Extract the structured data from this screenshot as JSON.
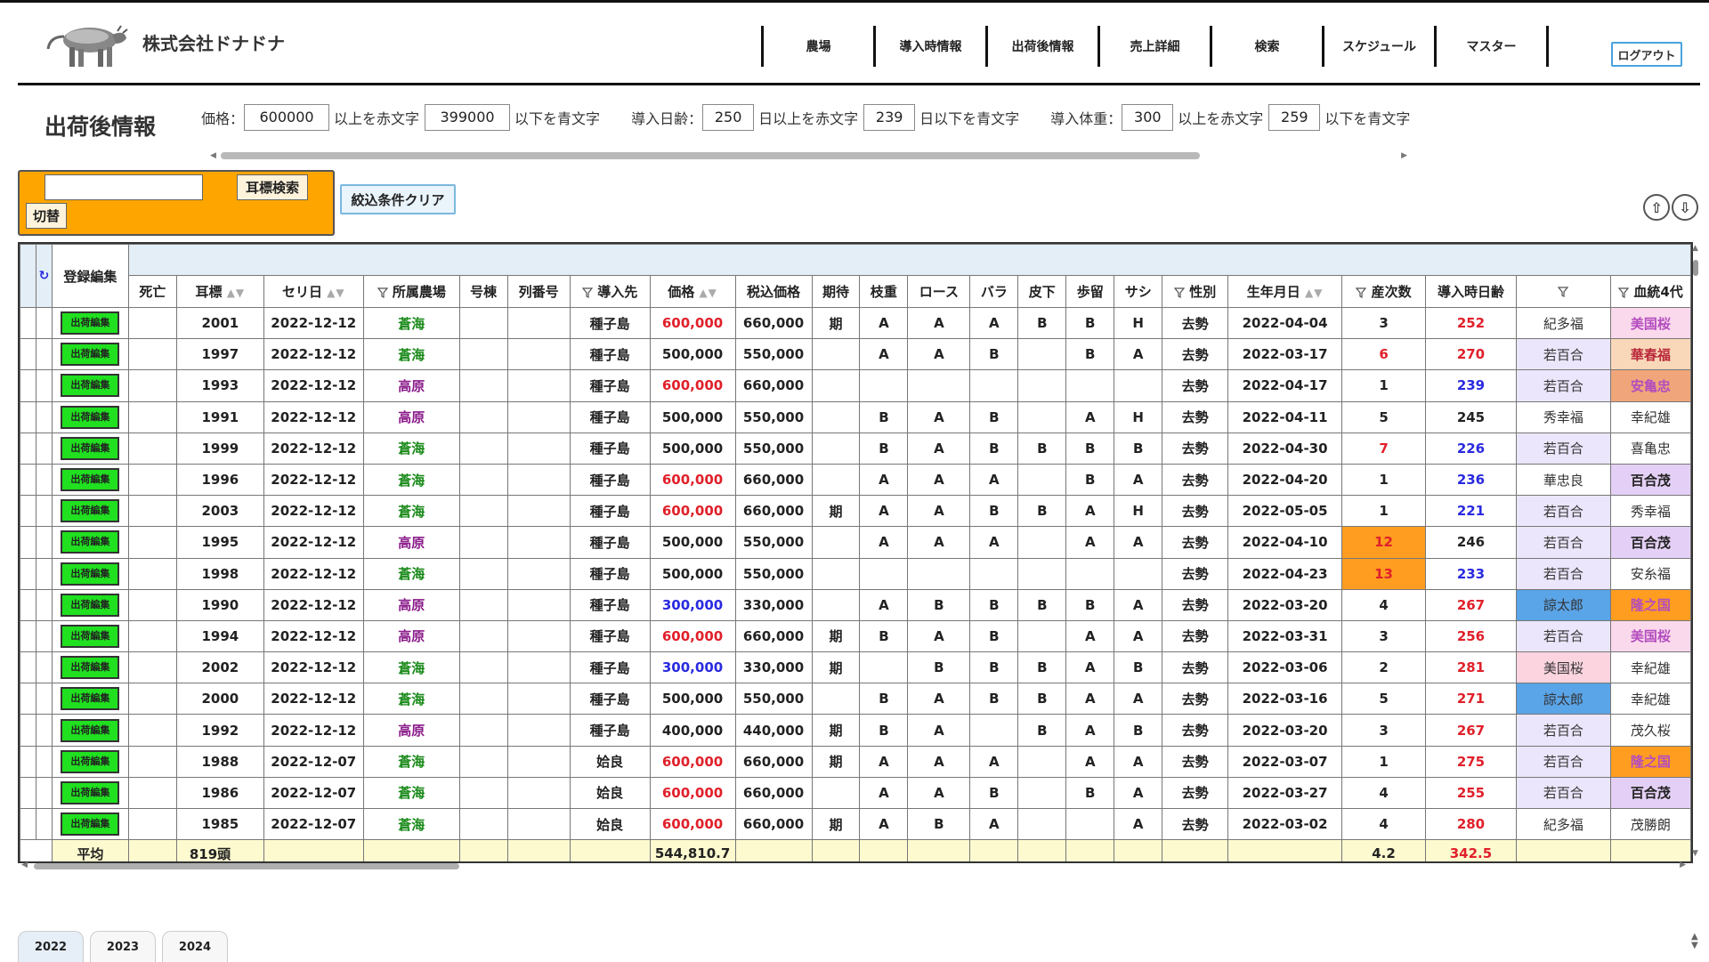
{
  "company": "株式会社ドナドナ",
  "nav": [
    "農場",
    "導入時情報",
    "出荷後情報",
    "売上詳細",
    "検索",
    "スケジュール",
    "マスター"
  ],
  "logout": "ログアウト",
  "page_title": "出荷後情報",
  "filters": [
    {
      "label": "価格：",
      "v1": "600000",
      "t1": "以上を赤文字",
      "v2": "399000",
      "t2": "以下を青文字"
    },
    {
      "label": "導入日齢：",
      "v1": "250",
      "t1": "日以上を赤文字",
      "v2": "239",
      "t2": "日以下を青文字"
    },
    {
      "label": "導入体重：",
      "v1": "300",
      "t1": "以上を赤文字",
      "v2": "259",
      "t2": "以下を青文字"
    }
  ],
  "search": {
    "ear_search": "耳標検索",
    "switch": "切替",
    "clear": "絞込条件クリア",
    "up_icon": "⇧",
    "down_icon": "⇩"
  },
  "table": {
    "group_header": "登録編集",
    "refresh_icon": "↻",
    "columns": [
      "死亡",
      "耳標",
      "セリ日",
      "所属農場",
      "号棟",
      "列番号",
      "導入先",
      "価格",
      "税込価格",
      "期待",
      "枝重",
      "ロース",
      "バラ",
      "皮下",
      "歩留",
      "サシ",
      "性別",
      "生年月日",
      "産次数",
      "導入時日齢",
      "",
      "血統4代"
    ],
    "edit_label": "出荷編集",
    "rows": [
      {
        "ear": "2001",
        "date": "2022-12-12",
        "farm": "蒼海",
        "src": "種子島",
        "price": "600,000",
        "tax": "660,000",
        "exp": "期",
        "g1": "A",
        "g2": "A",
        "g3": "A",
        "g4": "B",
        "g5": "B",
        "g6": "H",
        "sex": "去勢",
        "birth": "2022-04-04",
        "parity": "3",
        "age": "252",
        "b1": "紀多福",
        "b2": "美国桜"
      },
      {
        "ear": "1997",
        "date": "2022-12-12",
        "farm": "蒼海",
        "src": "種子島",
        "price": "500,000",
        "tax": "550,000",
        "exp": "",
        "g1": "A",
        "g2": "A",
        "g3": "B",
        "g4": "",
        "g5": "B",
        "g6": "A",
        "sex": "去勢",
        "birth": "2022-03-17",
        "parity": "6",
        "age": "270",
        "b1": "若百合",
        "b2": "華春福"
      },
      {
        "ear": "1993",
        "date": "2022-12-12",
        "farm": "高原",
        "src": "種子島",
        "price": "600,000",
        "tax": "660,000",
        "exp": "",
        "g1": "",
        "g2": "",
        "g3": "",
        "g4": "",
        "g5": "",
        "g6": "",
        "sex": "去勢",
        "birth": "2022-04-17",
        "parity": "1",
        "age": "239",
        "b1": "若百合",
        "b2": "安亀忠"
      },
      {
        "ear": "1991",
        "date": "2022-12-12",
        "farm": "高原",
        "src": "種子島",
        "price": "500,000",
        "tax": "550,000",
        "exp": "",
        "g1": "B",
        "g2": "A",
        "g3": "B",
        "g4": "",
        "g5": "A",
        "g6": "H",
        "sex": "去勢",
        "birth": "2022-04-11",
        "parity": "5",
        "age": "245",
        "b1": "秀幸福",
        "b2": "幸紀雄"
      },
      {
        "ear": "1999",
        "date": "2022-12-12",
        "farm": "蒼海",
        "src": "種子島",
        "price": "500,000",
        "tax": "550,000",
        "exp": "",
        "g1": "B",
        "g2": "A",
        "g3": "B",
        "g4": "B",
        "g5": "B",
        "g6": "B",
        "sex": "去勢",
        "birth": "2022-04-30",
        "parity": "7",
        "age": "226",
        "b1": "若百合",
        "b2": "喜亀忠"
      },
      {
        "ear": "1996",
        "date": "2022-12-12",
        "farm": "蒼海",
        "src": "種子島",
        "price": "600,000",
        "tax": "660,000",
        "exp": "",
        "g1": "A",
        "g2": "A",
        "g3": "A",
        "g4": "",
        "g5": "B",
        "g6": "A",
        "sex": "去勢",
        "birth": "2022-04-20",
        "parity": "1",
        "age": "236",
        "b1": "華忠良",
        "b2": "百合茂"
      },
      {
        "ear": "2003",
        "date": "2022-12-12",
        "farm": "蒼海",
        "src": "種子島",
        "price": "600,000",
        "tax": "660,000",
        "exp": "期",
        "g1": "A",
        "g2": "A",
        "g3": "B",
        "g4": "B",
        "g5": "A",
        "g6": "H",
        "sex": "去勢",
        "birth": "2022-05-05",
        "parity": "1",
        "age": "221",
        "b1": "若百合",
        "b2": "秀幸福"
      },
      {
        "ear": "1995",
        "date": "2022-12-12",
        "farm": "高原",
        "src": "種子島",
        "price": "500,000",
        "tax": "550,000",
        "exp": "",
        "g1": "A",
        "g2": "A",
        "g3": "A",
        "g4": "",
        "g5": "A",
        "g6": "A",
        "sex": "去勢",
        "birth": "2022-04-10",
        "parity": "12",
        "age": "246",
        "b1": "若百合",
        "b2": "百合茂"
      },
      {
        "ear": "1998",
        "date": "2022-12-12",
        "farm": "蒼海",
        "src": "種子島",
        "price": "500,000",
        "tax": "550,000",
        "exp": "",
        "g1": "",
        "g2": "",
        "g3": "",
        "g4": "",
        "g5": "",
        "g6": "",
        "sex": "去勢",
        "birth": "2022-04-23",
        "parity": "13",
        "age": "233",
        "b1": "若百合",
        "b2": "安糸福"
      },
      {
        "ear": "1990",
        "date": "2022-12-12",
        "farm": "高原",
        "src": "種子島",
        "price": "300,000",
        "tax": "330,000",
        "exp": "",
        "g1": "A",
        "g2": "B",
        "g3": "B",
        "g4": "B",
        "g5": "B",
        "g6": "A",
        "sex": "去勢",
        "birth": "2022-03-20",
        "parity": "4",
        "age": "267",
        "b1": "諒太郎",
        "b2": "隆之国"
      },
      {
        "ear": "1994",
        "date": "2022-12-12",
        "farm": "高原",
        "src": "種子島",
        "price": "600,000",
        "tax": "660,000",
        "exp": "期",
        "g1": "B",
        "g2": "A",
        "g3": "B",
        "g4": "",
        "g5": "A",
        "g6": "A",
        "sex": "去勢",
        "birth": "2022-03-31",
        "parity": "3",
        "age": "256",
        "b1": "若百合",
        "b2": "美国桜"
      },
      {
        "ear": "2002",
        "date": "2022-12-12",
        "farm": "蒼海",
        "src": "種子島",
        "price": "300,000",
        "tax": "330,000",
        "exp": "期",
        "g1": "",
        "g2": "B",
        "g3": "B",
        "g4": "B",
        "g5": "A",
        "g6": "B",
        "sex": "去勢",
        "birth": "2022-03-06",
        "parity": "2",
        "age": "281",
        "b1": "美国桜",
        "b2": "幸紀雄"
      },
      {
        "ear": "2000",
        "date": "2022-12-12",
        "farm": "蒼海",
        "src": "種子島",
        "price": "500,000",
        "tax": "550,000",
        "exp": "",
        "g1": "B",
        "g2": "A",
        "g3": "B",
        "g4": "B",
        "g5": "A",
        "g6": "A",
        "sex": "去勢",
        "birth": "2022-03-16",
        "parity": "5",
        "age": "271",
        "b1": "諒太郎",
        "b2": "幸紀雄"
      },
      {
        "ear": "1992",
        "date": "2022-12-12",
        "farm": "高原",
        "src": "種子島",
        "price": "400,000",
        "tax": "440,000",
        "exp": "期",
        "g1": "B",
        "g2": "A",
        "g3": "",
        "g4": "B",
        "g5": "A",
        "g6": "B",
        "sex": "去勢",
        "birth": "2022-03-20",
        "parity": "3",
        "age": "267",
        "b1": "若百合",
        "b2": "茂久桜"
      },
      {
        "ear": "1988",
        "date": "2022-12-07",
        "farm": "蒼海",
        "src": "姶良",
        "price": "600,000",
        "tax": "660,000",
        "exp": "期",
        "g1": "A",
        "g2": "A",
        "g3": "A",
        "g4": "",
        "g5": "A",
        "g6": "A",
        "sex": "去勢",
        "birth": "2022-03-07",
        "parity": "1",
        "age": "275",
        "b1": "若百合",
        "b2": "隆之国"
      },
      {
        "ear": "1986",
        "date": "2022-12-07",
        "farm": "蒼海",
        "src": "姶良",
        "price": "600,000",
        "tax": "660,000",
        "exp": "",
        "g1": "A",
        "g2": "A",
        "g3": "B",
        "g4": "",
        "g5": "B",
        "g6": "A",
        "sex": "去勢",
        "birth": "2022-03-27",
        "parity": "4",
        "age": "255",
        "b1": "若百合",
        "b2": "百合茂"
      },
      {
        "ear": "1985",
        "date": "2022-12-07",
        "farm": "蒼海",
        "src": "姶良",
        "price": "600,000",
        "tax": "660,000",
        "exp": "期",
        "g1": "A",
        "g2": "B",
        "g3": "A",
        "g4": "",
        "g5": "",
        "g6": "A",
        "sex": "去勢",
        "birth": "2022-03-02",
        "parity": "4",
        "age": "280",
        "b1": "紀多福",
        "b2": "茂勝朗"
      }
    ],
    "footer": {
      "label": "平均",
      "count": "819頭",
      "price": "544,810.7",
      "parity": "4.2",
      "age": "342.5"
    }
  },
  "year_tabs": [
    "2022",
    "2023",
    "2024"
  ]
}
